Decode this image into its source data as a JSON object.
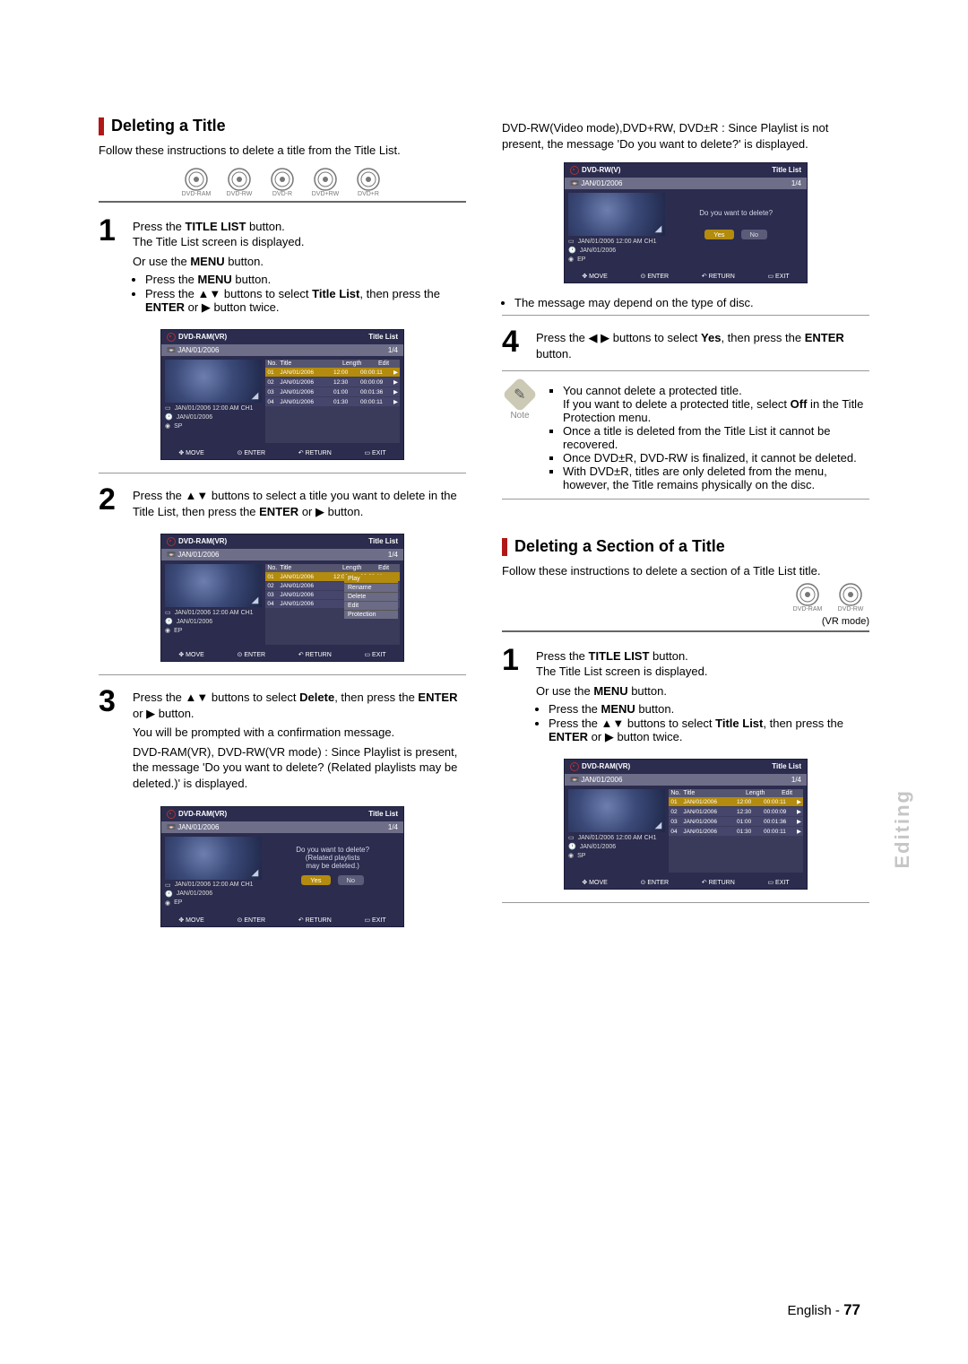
{
  "sideTab": "Editing",
  "footer": {
    "lang": "English",
    "sep": " - ",
    "page": "77"
  },
  "discs": {
    "ram": "DVD-RAM",
    "rw": "DVD-RW",
    "r": "DVD-R",
    "prw": "DVD+RW",
    "pr": "DVD+R"
  },
  "left": {
    "sec1_title": "Deleting a Title",
    "intro": "Follow these instructions to delete a title from the Title List.",
    "step1a": "Press the ",
    "step1b": "TITLE LIST",
    "step1c": " button.",
    "step1d": "The Title List screen is displayed.",
    "or1": "Or use the ",
    "or2": "MENU",
    "or3": " button.",
    "b1a": "Press the ",
    "b1b": "MENU",
    "b1c": " button.",
    "b2a": "Press the ▲▼ buttons to select ",
    "b2b": "Title List",
    "b2c": ", then press the ",
    "b2d": "ENTER",
    "b2e": " or ▶ button twice.",
    "step2a": "Press the ▲▼ buttons to select a title you want to delete in the Title List, then press the ",
    "step2b": "ENTER",
    "step2c": " or ▶ button.",
    "step3a": "Press the ▲▼ buttons to select ",
    "step3b": "Delete",
    "step3c": ", then press the ",
    "step3d": "ENTER",
    "step3e": " or ▶ button.",
    "step3f": "You will be prompted with a confirmation message.",
    "step3g": "DVD-RAM(VR), DVD-RW(VR mode) : Since Playlist is present, the message 'Do you want to delete? (Related playlists may be deleted.)' is displayed."
  },
  "right": {
    "top": "DVD-RW(Video mode),DVD+RW, DVD±R : Since Playlist is not present, the message 'Do you want to delete?' is displayed.",
    "afterScr": "The message may depend on the type of disc.",
    "step4a": "Press the ◀ ▶ buttons to select ",
    "step4b": "Yes",
    "step4c": ", then press the ",
    "step4d": "ENTER",
    "step4e": " button.",
    "note1a": "You cannot delete a protected title.",
    "note1b": "If you want to delete a protected title, select ",
    "note1c": "Off",
    "note1d": " in the Title Protection menu.",
    "note2": "Once a title is deleted from the Title List it cannot be recovered.",
    "note3": "Once DVD±R, DVD-RW is finalized, it cannot be deleted.",
    "note4": "With DVD±R, titles are only deleted from the menu, however, the Title remains physically on the disc.",
    "noteLabel": "Note",
    "sec2_title": "Deleting a Section of a Title",
    "sec2_intro": "Follow these instructions to delete a section of a Title List title.",
    "vrmode": "(VR mode)",
    "r_step1a": "Press the ",
    "r_step1b": "TITLE LIST",
    "r_step1c": " button.",
    "r_step1d": "The Title List screen is displayed.",
    "r_or1": "Or use the ",
    "r_or2": "MENU",
    "r_or3": " button.",
    "r_b1a": "Press the ",
    "r_b1b": "MENU",
    "r_b1c": " button.",
    "r_b2a": "Press the ▲▼ buttons to select ",
    "r_b2b": "Title List",
    "r_b2c": ", then press the ",
    "r_b2d": "ENTER",
    "r_b2e": " or ▶ button twice."
  },
  "screens": {
    "common": {
      "titleList": "Title List",
      "date": "JAN/01/2006",
      "page": "1/4",
      "hdr_no": "No.",
      "hdr_title": "Title",
      "hdr_len": "Length",
      "hdr_edit": "Edit",
      "foot_move": "MOVE",
      "foot_enter": "ENTER",
      "foot_return": "RETURN",
      "foot_exit": "EXIT",
      "info_title": "JAN/01/2006 12:00 AM CH1",
      "info_date": "JAN/01/2006"
    },
    "dev_ramvr": "DVD-RAM(VR)",
    "dev_rwv": "DVD-RW(V)",
    "rows": [
      {
        "n": "01",
        "t": "JAN/01/2006",
        "tm": "12:00",
        "len": "00:00:11"
      },
      {
        "n": "02",
        "t": "JAN/01/2006",
        "tm": "12:30",
        "len": "00:00:09"
      },
      {
        "n": "03",
        "t": "JAN/01/2006",
        "tm": "01:00",
        "len": "00:01:36"
      },
      {
        "n": "04",
        "t": "JAN/01/2006",
        "tm": "01:30",
        "len": "00:00:11"
      }
    ],
    "quality_sp": "SP",
    "quality_ep": "EP",
    "menu": {
      "play": "Play",
      "rename": "Rename",
      "delete": "Delete",
      "edit": "Edit",
      "protection": "Protection"
    },
    "dlg1a": "Do you want to delete?",
    "dlg1b": "(Related playlists",
    "dlg1c": "may be deleted.)",
    "dlg2": "Do you want to delete?",
    "yes": "Yes",
    "no": "No"
  }
}
